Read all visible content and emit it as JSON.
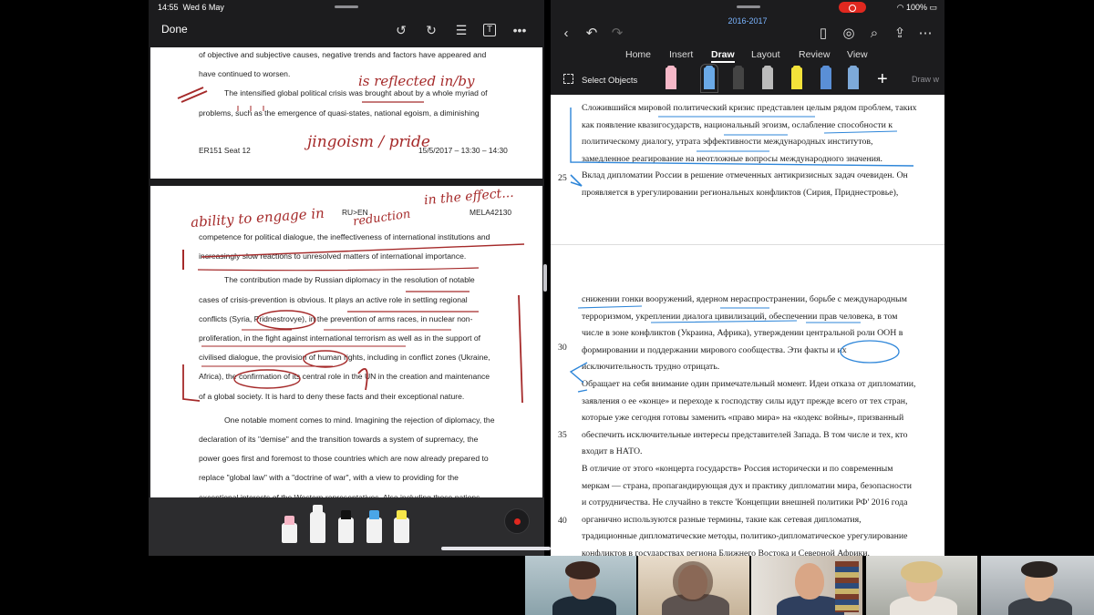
{
  "left_pane": {
    "status": {
      "time": "14:55",
      "date": "Wed 6 May"
    },
    "toolbar": {
      "done_label": "Done",
      "icons": [
        "undo-icon",
        "redo-icon",
        "reader-icon",
        "text-tool-icon",
        "more-icon"
      ]
    },
    "page1": {
      "lines": [
        "of objective and subjective causes, negative trends and factors have appeared and",
        "have continued to worsen.",
        "The intensified global political crisis was brought about by a whole myriad of",
        "problems, such as the emergence of quasi-states, national egoism, a diminishing"
      ],
      "footer_left": "ER151 Seat 12",
      "footer_right": "15/5/2017 – 13:30 – 14:30",
      "annotations": [
        "is reflected in/by",
        "jingoism / pride"
      ]
    },
    "page2": {
      "header_center": "RU>EN",
      "header_right": "MELA42130",
      "lines": [
        "competence for political dialogue, the ineffectiveness of international institutions and",
        "increasingly slow reactions to unresolved matters of international importance.",
        "The contribution made by Russian diplomacy in the resolution of notable",
        "cases of crisis-prevention is obvious. It plays an active role in settling regional",
        "conflicts (Syria, Pridnestrovye), in the prevention of arms races, in nuclear non-",
        "proliferation, in the fight against international terrorism as well as in the support of",
        "civilised dialogue, the provision of human rights, including in conflict zones (Ukraine,",
        "Africa), the confirmation of its central role in the UN in the creation and maintenance",
        "of a global society. It is hard to deny these facts and their exceptional nature.",
        "One notable moment comes to mind. Imagining the rejection of diplomacy, the",
        "declaration of its \"demise\" and the transition towards a system of supremacy, the",
        "power goes first and foremost to those countries which are now already prepared to",
        "replace \"global law\" with a \"doctrine of war\", with a view to providing for the",
        "exceptional interests of the Western representatives. Also including those nations"
      ],
      "annotations": [
        "ability to engage in",
        "reduction",
        "in the effect..."
      ]
    },
    "tools": [
      "eraser-tool",
      "pen-tool",
      "marker-tool",
      "blue-pencil-tool",
      "highlighter-tool"
    ]
  },
  "right_pane": {
    "status": {
      "battery": "100%"
    },
    "doc_title": "2016-2017",
    "tabs": [
      "Home",
      "Insert",
      "Draw",
      "Layout",
      "Review",
      "View"
    ],
    "active_tab": "Draw",
    "draw_toolbar": {
      "select_label": "Select Objects",
      "draw_label": "Draw w"
    },
    "block1": [
      "Сложившийся мировой политический кризис представлен целым рядом проблем, таких",
      "как появление квазигосударств, национальный эгоизм, ослабление способности к",
      "политическому диалогу, утрата эффективности международных институтов,",
      "замедленное реагирование на неотложные вопросы международного значения.",
      "Вклад дипломатии России в решение отмеченных антикризисных задач очевиден. Он",
      "проявляется в урегулировании региональных конфликтов (Сирия, Приднестровье),"
    ],
    "block2": [
      "снижении гонки вооружений, ядерном нераспространении, борьбе с международным",
      "терроризмом, укреплении диалога цивилизаций, обеспечении прав человека, в том",
      "числе в зоне конфликтов (Украина, Африка), утверждении центральной роли ООН в",
      "формировании и поддержании мирового сообщества. Эти факты и их",
      "исключительность трудно отрицать.",
      "Обращает на себя внимание один примечательный момент. Идеи отказа от дипломатии,",
      "заявления о ее «конце» и переходе к господству силы идут прежде всего от тех стран,",
      "которые уже сегодня готовы заменить «право мира» на «кодекс войны», призванный",
      "обеспечить исключительные интересы представителей Запада. В том числе и тех, кто",
      "входит в НАТО.",
      "В отличие от этого «концерта государств» Россия исторически и по современным",
      "меркам — страна, пропагандирующая дух и практику дипломатии мира, безопасности",
      "и сотрудничества. Не случайно в тексте 'Концепции внешней политики РФ' 2016 года",
      "органично используются разные термины, такие как сетевая дипломатия,",
      "традиционные дипломатические методы, политико-дипломатическое урегулирование",
      "конфликтов в государствах региона Ближнего Востока и Северной Африки."
    ],
    "line_numbers": [
      "25",
      "30",
      "35",
      "40"
    ]
  },
  "video_strip": [
    "participant-1",
    "participant-2",
    "participant-3",
    "participant-4",
    "participant-5"
  ]
}
